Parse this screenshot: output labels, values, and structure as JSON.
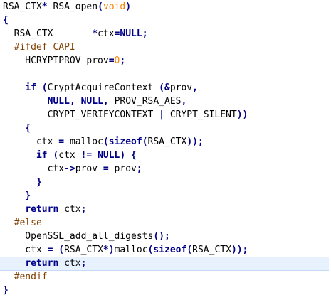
{
  "code": {
    "highlighted_line_index": 19,
    "lines": [
      [
        {
          "t": "RSA_CTX",
          "c": "tk"
        },
        {
          "t": "* ",
          "c": "op"
        },
        {
          "t": "RSA_open",
          "c": "tk"
        },
        {
          "t": "(",
          "c": "op"
        },
        {
          "t": "void",
          "c": "pc"
        },
        {
          "t": ")",
          "c": "op"
        }
      ],
      [
        {
          "t": "{",
          "c": "op"
        }
      ],
      [
        {
          "t": "  RSA_CTX       ",
          "c": "tk"
        },
        {
          "t": "*",
          "c": "op"
        },
        {
          "t": "ctx",
          "c": "tk"
        },
        {
          "t": "=",
          "c": "op"
        },
        {
          "t": "NULL",
          "c": "kb"
        },
        {
          "t": ";",
          "c": "op"
        }
      ],
      [
        {
          "t": "  #ifdef CAPI",
          "c": "pp"
        }
      ],
      [
        {
          "t": "    HCRYPTPROV prov",
          "c": "tk"
        },
        {
          "t": "=",
          "c": "op"
        },
        {
          "t": "0",
          "c": "num"
        },
        {
          "t": ";",
          "c": "op"
        }
      ],
      [
        {
          "t": "",
          "c": "tk"
        }
      ],
      [
        {
          "t": "    ",
          "c": "tk"
        },
        {
          "t": "if",
          "c": "kb"
        },
        {
          "t": " ",
          "c": "tk"
        },
        {
          "t": "(",
          "c": "op"
        },
        {
          "t": "CryptAcquireContext ",
          "c": "tk"
        },
        {
          "t": "(&",
          "c": "op"
        },
        {
          "t": "prov",
          "c": "tk"
        },
        {
          "t": ",",
          "c": "op"
        }
      ],
      [
        {
          "t": "        ",
          "c": "tk"
        },
        {
          "t": "NULL",
          "c": "kb"
        },
        {
          "t": ", ",
          "c": "op"
        },
        {
          "t": "NULL",
          "c": "kb"
        },
        {
          "t": ", ",
          "c": "op"
        },
        {
          "t": "PROV_RSA_AES",
          "c": "tk"
        },
        {
          "t": ",",
          "c": "op"
        }
      ],
      [
        {
          "t": "        CRYPT_VERIFYCONTEXT ",
          "c": "tk"
        },
        {
          "t": "| ",
          "c": "op"
        },
        {
          "t": "CRYPT_SILENT",
          "c": "tk"
        },
        {
          "t": "))",
          "c": "op"
        }
      ],
      [
        {
          "t": "    ",
          "c": "tk"
        },
        {
          "t": "{",
          "c": "op"
        }
      ],
      [
        {
          "t": "      ctx ",
          "c": "tk"
        },
        {
          "t": "= ",
          "c": "op"
        },
        {
          "t": "malloc",
          "c": "tk"
        },
        {
          "t": "(",
          "c": "op"
        },
        {
          "t": "sizeof",
          "c": "kb"
        },
        {
          "t": "(",
          "c": "op"
        },
        {
          "t": "RSA_CTX",
          "c": "tk"
        },
        {
          "t": "));",
          "c": "op"
        }
      ],
      [
        {
          "t": "      ",
          "c": "tk"
        },
        {
          "t": "if",
          "c": "kb"
        },
        {
          "t": " ",
          "c": "tk"
        },
        {
          "t": "(",
          "c": "op"
        },
        {
          "t": "ctx ",
          "c": "tk"
        },
        {
          "t": "!= ",
          "c": "op"
        },
        {
          "t": "NULL",
          "c": "kb"
        },
        {
          "t": ") {",
          "c": "op"
        }
      ],
      [
        {
          "t": "        ctx",
          "c": "tk"
        },
        {
          "t": "->",
          "c": "op"
        },
        {
          "t": "prov ",
          "c": "tk"
        },
        {
          "t": "= ",
          "c": "op"
        },
        {
          "t": "prov",
          "c": "tk"
        },
        {
          "t": ";",
          "c": "op"
        }
      ],
      [
        {
          "t": "      ",
          "c": "tk"
        },
        {
          "t": "}",
          "c": "op"
        }
      ],
      [
        {
          "t": "    ",
          "c": "tk"
        },
        {
          "t": "}",
          "c": "op"
        }
      ],
      [
        {
          "t": "    ",
          "c": "tk"
        },
        {
          "t": "return",
          "c": "kb"
        },
        {
          "t": " ctx",
          "c": "tk"
        },
        {
          "t": ";",
          "c": "op"
        }
      ],
      [
        {
          "t": "  #else",
          "c": "pp"
        }
      ],
      [
        {
          "t": "    OpenSSL_add_all_digests",
          "c": "tk"
        },
        {
          "t": "();",
          "c": "op"
        }
      ],
      [
        {
          "t": "    ctx ",
          "c": "tk"
        },
        {
          "t": "= (",
          "c": "op"
        },
        {
          "t": "RSA_CTX",
          "c": "tk"
        },
        {
          "t": "*)",
          "c": "op"
        },
        {
          "t": "malloc",
          "c": "tk"
        },
        {
          "t": "(",
          "c": "op"
        },
        {
          "t": "sizeof",
          "c": "kb"
        },
        {
          "t": "(",
          "c": "op"
        },
        {
          "t": "RSA_CTX",
          "c": "tk"
        },
        {
          "t": "));",
          "c": "op"
        }
      ],
      [
        {
          "t": "    ",
          "c": "tk"
        },
        {
          "t": "return",
          "c": "kb"
        },
        {
          "t": " ctx",
          "c": "tk"
        },
        {
          "t": ";",
          "c": "op"
        }
      ],
      [
        {
          "t": "  #endif",
          "c": "pp"
        }
      ],
      [
        {
          "t": "}",
          "c": "op"
        }
      ]
    ]
  }
}
